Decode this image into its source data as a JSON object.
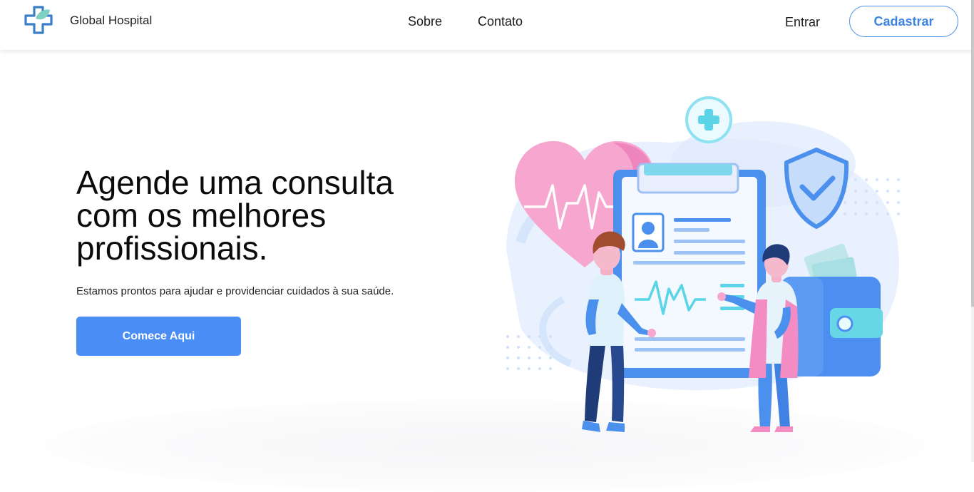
{
  "brand": {
    "name": "Global Hospital"
  },
  "nav": {
    "links": [
      {
        "label": "Sobre"
      },
      {
        "label": "Contato"
      }
    ],
    "login_label": "Entrar",
    "signup_label": "Cadastrar"
  },
  "hero": {
    "title_lines": [
      "Agende uma consulta",
      "com os melhores",
      "profissionais."
    ],
    "subtitle": "Estamos prontos para ajudar e providenciar cuidados à sua saúde.",
    "cta_label": "Comece Aqui"
  },
  "colors": {
    "accent": "#4a8ef5",
    "heart": "#f48cc4",
    "clipboard_blue": "#4c90ee",
    "teal": "#5bd4e8"
  },
  "icons": [
    "hospital-cross-logo-icon",
    "shield-check-icon",
    "heart-pulse-icon",
    "plus-circle-icon",
    "wallet-icon"
  ]
}
